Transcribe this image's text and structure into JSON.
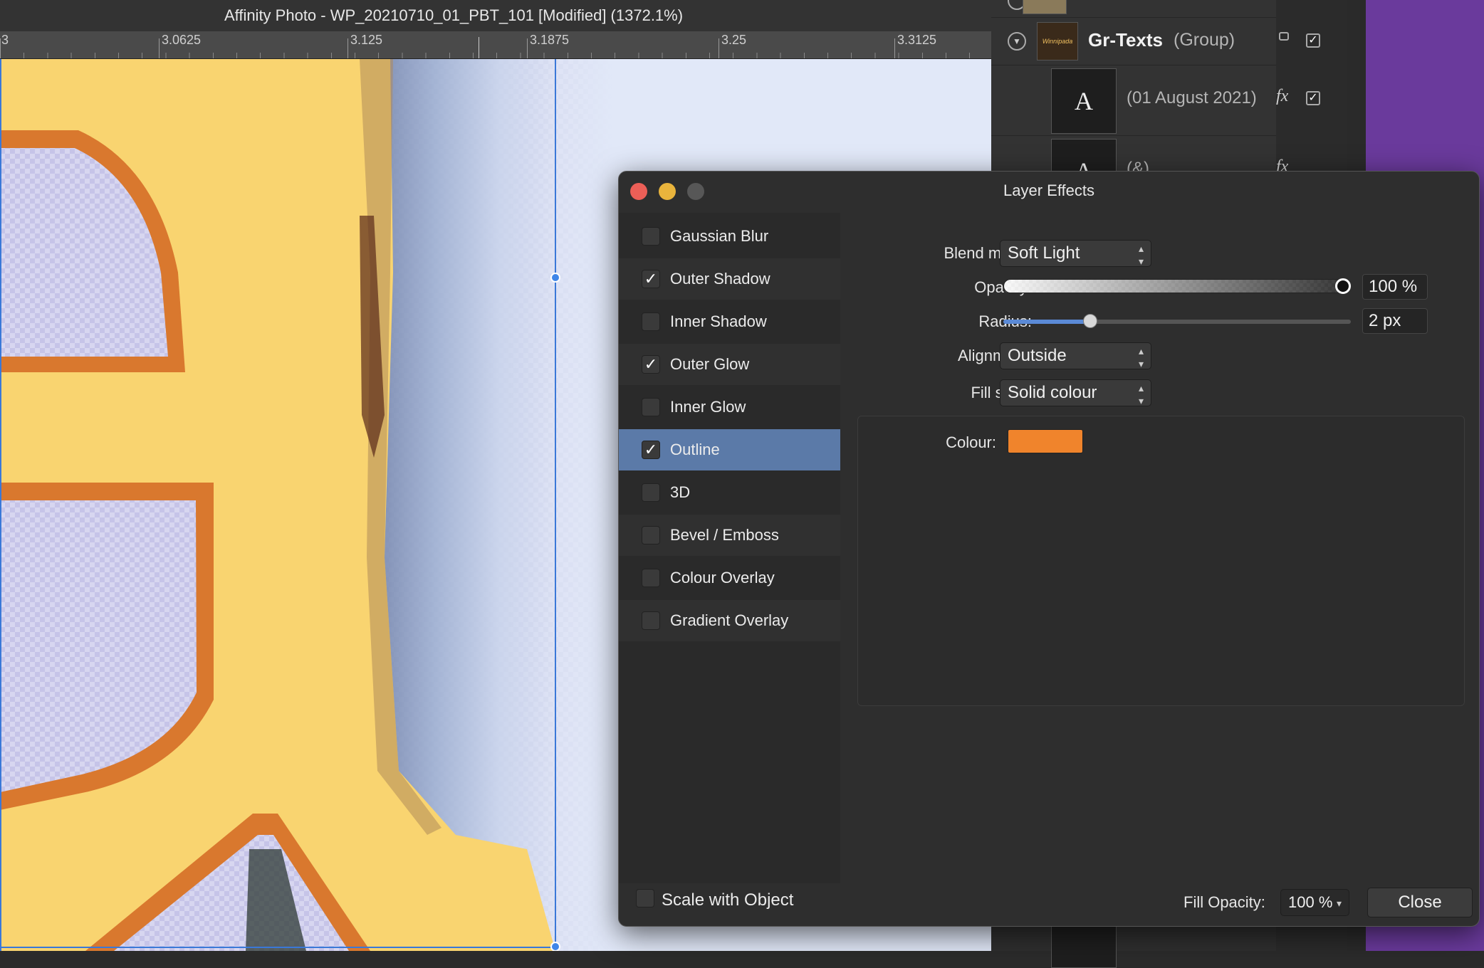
{
  "window": {
    "title": "Affinity Photo - WP_20210710_01_PBT_101 [Modified] (1372.1%)"
  },
  "ruler": {
    "labels": [
      "3",
      "3.0625",
      "3.125",
      "3.1875",
      "3.25",
      "3.3125"
    ]
  },
  "layers_panel": {
    "group": {
      "name": "Gr-Texts",
      "type": "(Group)",
      "thumb_text": "Winnipada"
    },
    "text_layer_1": {
      "name": "(01 August 2021)",
      "thumb_glyph": "A",
      "fx": "fx"
    },
    "text_layer_2": {
      "name": "(&)",
      "thumb_glyph": "A",
      "fx": "fx"
    },
    "checkmark": "✓"
  },
  "dialog": {
    "title": "Layer Effects",
    "effects": [
      {
        "label": "Gaussian Blur",
        "checked": false
      },
      {
        "label": "Outer Shadow",
        "checked": true
      },
      {
        "label": "Inner Shadow",
        "checked": false
      },
      {
        "label": "Outer Glow",
        "checked": true
      },
      {
        "label": "Inner Glow",
        "checked": false
      },
      {
        "label": "Outline",
        "checked": true,
        "selected": true
      },
      {
        "label": "3D",
        "checked": false
      },
      {
        "label": "Bevel / Emboss",
        "checked": false
      },
      {
        "label": "Colour Overlay",
        "checked": false
      },
      {
        "label": "Gradient Overlay",
        "checked": false
      }
    ],
    "blend_mode": {
      "label": "Blend mode:",
      "value": "Soft Light"
    },
    "opacity": {
      "label": "Opacity:",
      "value": "100 %",
      "level": 1.0
    },
    "radius": {
      "label": "Radius:",
      "value": "2 px",
      "level": 0.25
    },
    "alignment": {
      "label": "Alignment:",
      "value": "Outside"
    },
    "fill_style": {
      "label": "Fill style:",
      "value": "Solid colour"
    },
    "colour": {
      "label": "Colour:",
      "swatch": "#f0842c"
    },
    "scale_with_object": {
      "label": "Scale with Object",
      "checked": false
    },
    "fill_opacity": {
      "label": "Fill Opacity:",
      "value": "100 %"
    },
    "close_label": "Close"
  },
  "colors": {
    "selection_blue": "#5b7aa8",
    "guide_blue": "#3a78d8",
    "letter_fill": "#f9d470",
    "outline_orange": "#d9782e",
    "purple_bg": "#6a3a9c"
  }
}
